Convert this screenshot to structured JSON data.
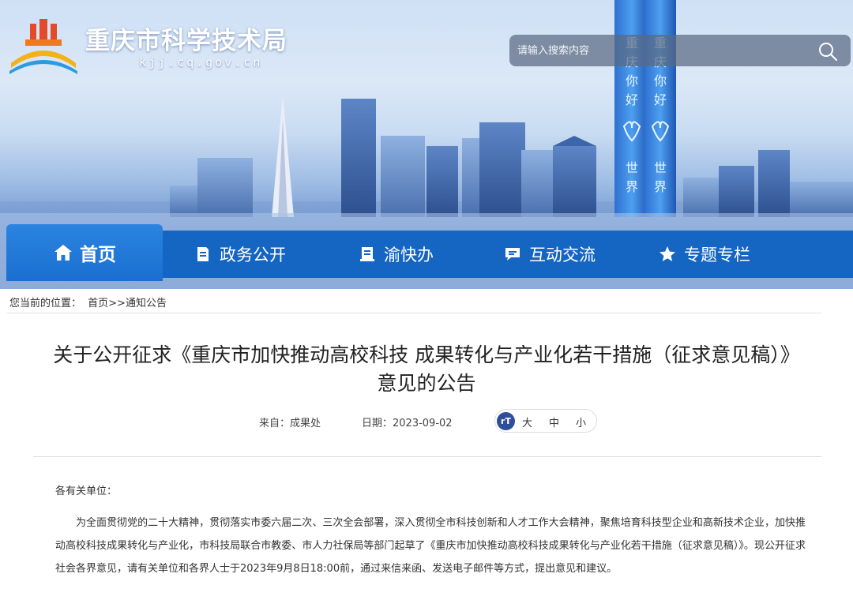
{
  "site": {
    "name": "重庆市科学技术局",
    "domain": "kjj.cq.gov.cn"
  },
  "search": {
    "placeholder": "请输入搜索内容"
  },
  "nav": {
    "home": "首页",
    "items": [
      {
        "label": "政务公开",
        "icon": "document-icon"
      },
      {
        "label": "渝快办",
        "icon": "book-icon"
      },
      {
        "label": "互动交流",
        "icon": "chat-icon"
      },
      {
        "label": "专题专栏",
        "icon": "star-icon"
      }
    ]
  },
  "breadcrumb": {
    "prefix": "您当前的位置：",
    "path": "首页>>通知公告"
  },
  "article": {
    "title": "关于公开征求《重庆市加快推动高校科技 成果转化与产业化若干措施（征求意见稿）》意见的公告",
    "source": "来自：成果处",
    "date": "日期：2023-09-02",
    "font_sizes": [
      "大",
      "中",
      "小"
    ],
    "salutation": "各有关单位：",
    "paragraph": "为全面贯彻党的二十大精神，贯彻落实市委六届二次、三次全会部署，深入贯彻全市科技创新和人才工作大会精神，聚焦培育科技型企业和高新技术企业，加快推动高校科技成果转化与产业化，市科技局联合市教委、市人力社保局等部门起草了《重庆市加快推动高校科技成果转化与产业化若干措施（征求意见稿）》。现公开征求社会各界意见，请有关单位和各界人士于2023年9月8日18:00前，通过来信来函、发送电子邮件等方式，提出意见和建议。"
  },
  "colors": {
    "nav_bg": "#1566c2",
    "nav_active": "#2b84e0",
    "font_icon": "#2f4e9a"
  }
}
